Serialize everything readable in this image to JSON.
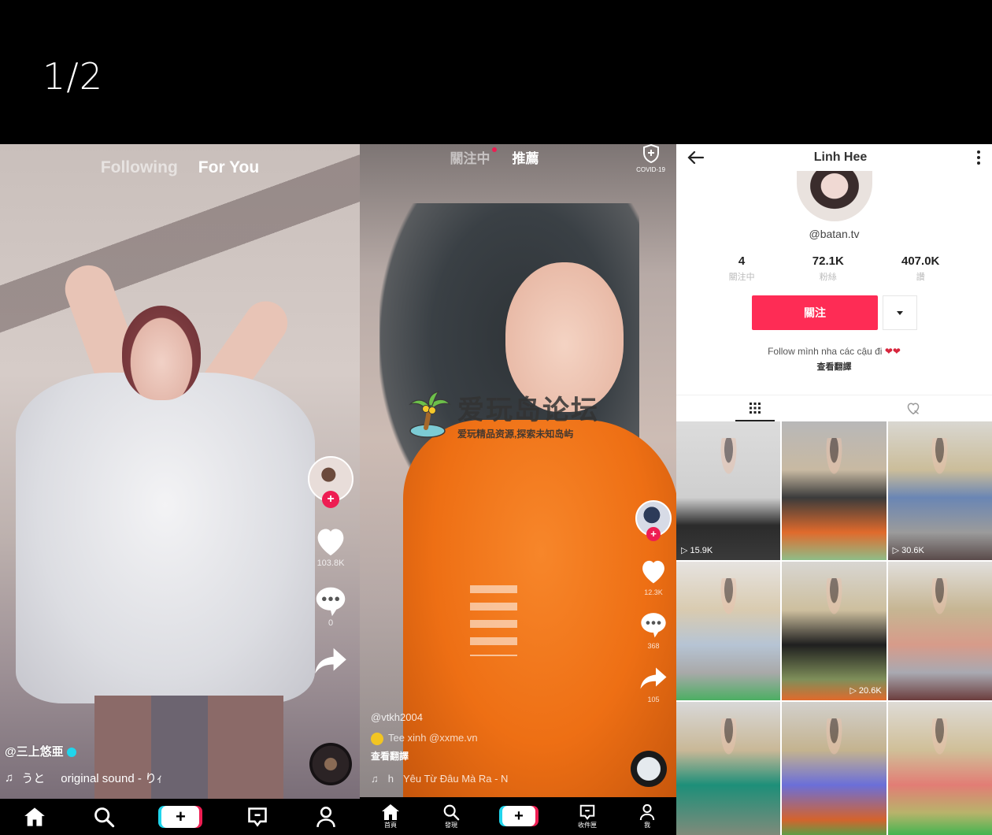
{
  "counter": "1/2",
  "panel1": {
    "tabs": [
      "Following",
      "For You"
    ],
    "active_tab": "For You",
    "likes": "103.8K",
    "comments": "0",
    "username": "@三上悠亜",
    "music_prefix": "うと",
    "music_title": "original sound - りｨ",
    "nav": [
      {
        "icon": "home-icon",
        "label": ""
      },
      {
        "icon": "search-icon",
        "label": ""
      },
      {
        "icon": "create-icon",
        "label": ""
      },
      {
        "icon": "inbox-icon",
        "label": ""
      },
      {
        "icon": "profile-icon",
        "label": ""
      }
    ]
  },
  "panel2": {
    "tabs": [
      "關注中",
      "推薦"
    ],
    "active_tab": "推薦",
    "covid_label": "COVID-19",
    "watermark_title": "爱玩岛论坛",
    "watermark_subtitle": "爱玩精品资源,探索未知岛屿",
    "likes": "12.3K",
    "comments": "368",
    "shares": "105",
    "username": "@vtkh2004",
    "description": "Tee xinh @xxme.vn",
    "translate": "查看翻譯",
    "music_prefix": "h",
    "music_title": "Yêu Từ Đâu Mà Ra - N",
    "nav": [
      {
        "icon": "home-icon",
        "label": "首頁"
      },
      {
        "icon": "search-icon",
        "label": "發現"
      },
      {
        "icon": "create-icon",
        "label": ""
      },
      {
        "icon": "inbox-icon",
        "label": "收件匣"
      },
      {
        "icon": "profile-icon",
        "label": "我"
      }
    ]
  },
  "panel3": {
    "title": "Linh Hee",
    "handle": "@batan.tv",
    "stats": [
      {
        "value": "4",
        "label": "關注中"
      },
      {
        "value": "72.1K",
        "label": "粉絲"
      },
      {
        "value": "407.0K",
        "label": "讚"
      }
    ],
    "follow_label": "關注",
    "bio": "Follow mình nha các cậu đi",
    "bio_hearts": "❤❤",
    "bio_translate": "查看翻譯",
    "videos": [
      {
        "views": "15.9K"
      },
      {
        "views": ""
      },
      {
        "views": "30.6K"
      },
      {
        "views": ""
      },
      {
        "views": "20.6K"
      },
      {
        "views": ""
      },
      {
        "views": ""
      },
      {
        "views": ""
      },
      {
        "views": ""
      }
    ]
  }
}
